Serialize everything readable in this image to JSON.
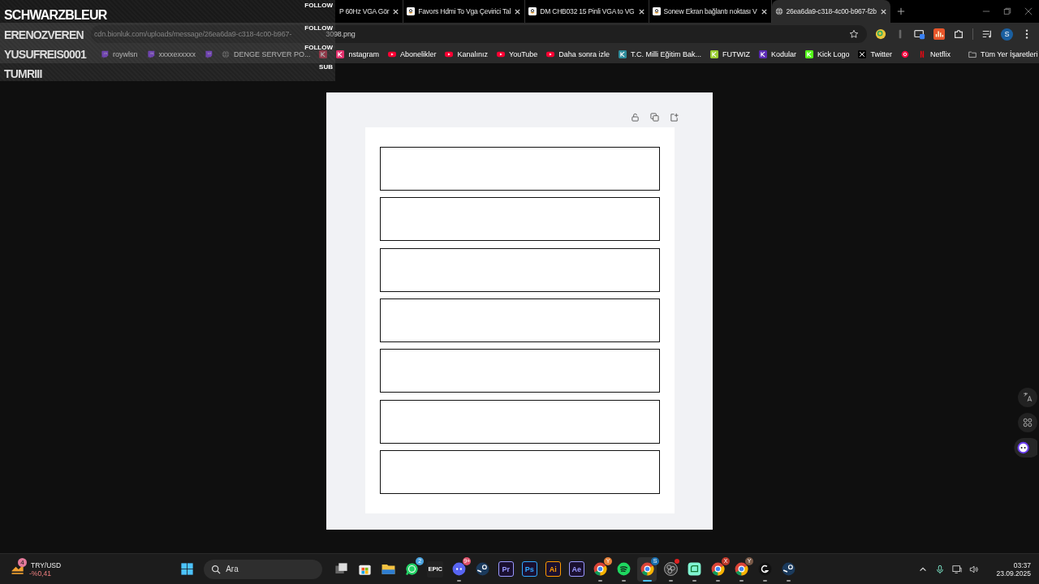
{
  "stream_overlay": {
    "rows": [
      {
        "name": "SCHWARZBLEUR",
        "action": "FOLLOW"
      },
      {
        "name": "ERENOZVEREN",
        "action": "FOLLOW"
      },
      {
        "name": "YUSUFREIS0001",
        "action": "FOLLOW"
      },
      {
        "name": "TUMRIII",
        "action": "SUB"
      }
    ]
  },
  "tabs": [
    {
      "title": "P 60Hz VGA Gör",
      "selected": false
    },
    {
      "title": "Favors Hdmi To Vga Çevirici Tal",
      "kind": "amazon",
      "selected": false
    },
    {
      "title": "DM CHB032 15 Pinli VGA to VG",
      "kind": "amazon",
      "selected": false
    },
    {
      "title": "Sonew Ekran bağlantı noktası V",
      "kind": "amazon",
      "selected": false
    },
    {
      "title": "26ea6da9-c318-4c00-b967-f2b",
      "kind": "globe",
      "selected": true
    }
  ],
  "address_bar": {
    "url_start": "cdn.bionluk.com/uploads/message/26ea6da9-c318-4c00-b967-",
    "url_end": "3098.png"
  },
  "profile_initial": "S",
  "bookmarks": [
    {
      "kind": "twitch",
      "label": "roywlsn"
    },
    {
      "kind": "twitch",
      "label": "xxxxexxxxx"
    },
    {
      "kind": "twitch"
    },
    {
      "kind": "globe",
      "label": "DENGE SERVER PO..."
    },
    {
      "kind": "yandex"
    },
    {
      "kind": "instagram",
      "label": "nstagram"
    },
    {
      "kind": "youtube",
      "label": "Abonelikler"
    },
    {
      "kind": "youtube",
      "label": "Kanalınız"
    },
    {
      "kind": "youtube",
      "label": "YouTube"
    },
    {
      "kind": "youtube",
      "label": "Daha sonra izle"
    },
    {
      "kind": "meb",
      "label": "T.C. Milli Eğitim Bak..."
    },
    {
      "kind": "futwiz",
      "label": "FUTWIZ"
    },
    {
      "kind": "kodular",
      "label": "Kodular"
    },
    {
      "kind": "kick",
      "label": "Kick Logo"
    },
    {
      "kind": "x",
      "label": "Twitter"
    },
    {
      "kind": "music"
    },
    {
      "kind": "netflix",
      "label": "Netflix"
    }
  ],
  "all_bookmarks": "Tüm Yer İşaretleri",
  "image": {
    "boxes": [
      {
        "kind": "blank"
      },
      {
        "kind": "blank"
      },
      {
        "kind": "blank"
      },
      {
        "kind": "blank"
      },
      {
        "kind": "blank"
      },
      {
        "kind": "blank"
      },
      {
        "kind": "blank"
      }
    ]
  },
  "taskbar": {
    "widget": {
      "badge": "4",
      "title": "TRY/USD",
      "change": "-%0,41"
    },
    "search_placeholder": "Ara",
    "apps": [
      {
        "kind": "taskview",
        "running": false,
        "selected": false
      },
      {
        "kind": "store",
        "running": false,
        "selected": false
      },
      {
        "kind": "explorer",
        "running": false,
        "selected": false
      },
      {
        "kind": "whatsapp",
        "running": false,
        "selected": false,
        "badge": "2",
        "color": "#4aa3df"
      },
      {
        "kind": "epic",
        "label": "EPIC",
        "running": false,
        "selected": false
      },
      {
        "kind": "discord",
        "running": true,
        "selected": false,
        "badge": "9+",
        "color": "#e0526b"
      },
      {
        "kind": "steam",
        "running": false,
        "selected": false
      },
      {
        "kind": "adobe",
        "label": "Pr",
        "color": "#9999ff",
        "running": false,
        "selected": false
      },
      {
        "kind": "adobe",
        "label": "Ps",
        "color": "#31a8ff",
        "running": false,
        "selected": false
      },
      {
        "kind": "adobe",
        "label": "Ai",
        "color": "#ff9a00",
        "running": false,
        "selected": false
      },
      {
        "kind": "adobe",
        "label": "Ae",
        "color": "#9999ff",
        "running": false,
        "selected": false
      },
      {
        "kind": "chrome",
        "running": true,
        "selected": false,
        "badge": "Y",
        "color": "#e8823a"
      },
      {
        "kind": "spotify",
        "running": true,
        "selected": false
      },
      {
        "kind": "chrome",
        "running": true,
        "selected": true,
        "badge": "S",
        "color": "#1a6fb0"
      },
      {
        "kind": "obs",
        "running": true,
        "selected": false,
        "dot": true
      },
      {
        "kind": "streamlabs",
        "running": true,
        "selected": false
      },
      {
        "kind": "chrome",
        "running": true,
        "selected": false,
        "badge": "X",
        "color": "#c0392b"
      },
      {
        "kind": "chrome",
        "running": true,
        "selected": false,
        "badge": "Y",
        "color": "#7a5a48"
      },
      {
        "kind": "logitech",
        "running": true,
        "selected": false
      },
      {
        "kind": "steam",
        "running": true,
        "selected": false
      }
    ],
    "time": "03:37",
    "date": "23.09.2025"
  }
}
